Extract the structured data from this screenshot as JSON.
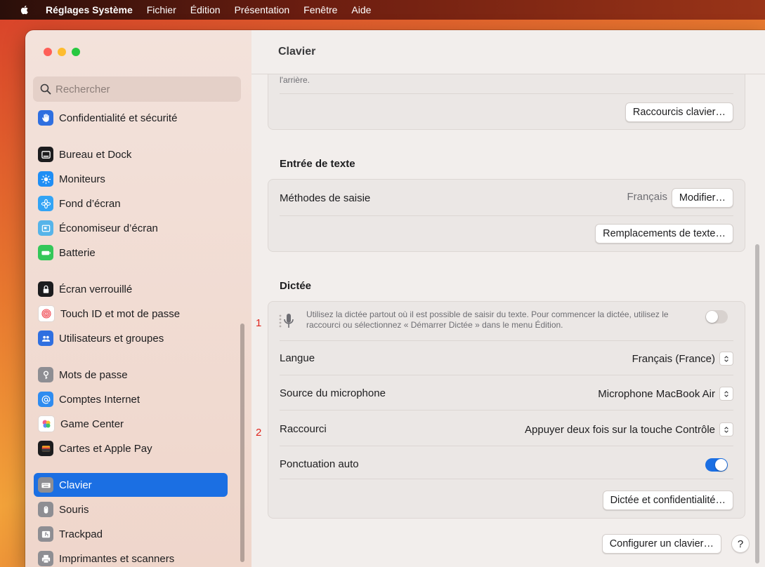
{
  "menubar": {
    "app": "Réglages Système",
    "items": [
      "Fichier",
      "Édition",
      "Présentation",
      "Fenêtre",
      "Aide"
    ]
  },
  "sidebar": {
    "search_placeholder": "Rechercher",
    "items": [
      {
        "label": "Confidentialité et sécurité",
        "icon": "hand-icon",
        "color": "#2f6fe0"
      },
      {
        "label": "Bureau et Dock",
        "icon": "dock-icon",
        "color": "#1c1c1e"
      },
      {
        "label": "Moniteurs",
        "icon": "sun-icon",
        "color": "#1f8ef5"
      },
      {
        "label": "Fond d’écran",
        "icon": "flower-icon",
        "color": "#33a4f5"
      },
      {
        "label": "Économiseur d’écran",
        "icon": "screensaver-icon",
        "color": "#56b4e9"
      },
      {
        "label": "Batterie",
        "icon": "battery-icon",
        "color": "#34c759"
      },
      {
        "label": "Écran verrouillé",
        "icon": "lock-icon",
        "color": "#1c1c1e"
      },
      {
        "label": "Touch ID et mot de passe",
        "icon": "fingerprint-icon",
        "color": "#ffffff"
      },
      {
        "label": "Utilisateurs et groupes",
        "icon": "users-icon",
        "color": "#2f6fe0"
      },
      {
        "label": "Mots de passe",
        "icon": "key-icon",
        "color": "#8e8e93"
      },
      {
        "label": "Comptes Internet",
        "icon": "at-icon",
        "color": "#2f8cf0"
      },
      {
        "label": "Game Center",
        "icon": "game-center-icon",
        "color": "#ffffff"
      },
      {
        "label": "Cartes et Apple Pay",
        "icon": "wallet-icon",
        "color": "#1c1c1e"
      },
      {
        "label": "Clavier",
        "icon": "keyboard-icon",
        "color": "#8e8e93"
      },
      {
        "label": "Souris",
        "icon": "mouse-icon",
        "color": "#8e8e93"
      },
      {
        "label": "Trackpad",
        "icon": "trackpad-icon",
        "color": "#8e8e93"
      },
      {
        "label": "Imprimantes et scanners",
        "icon": "printer-icon",
        "color": "#8e8e93"
      }
    ]
  },
  "content": {
    "title": "Clavier",
    "top_cut_text": "l'arrière.",
    "shortcuts_button": "Raccourcis clavier…",
    "text_input": {
      "section_title": "Entrée de texte",
      "input_methods_label": "Méthodes de saisie",
      "input_methods_value": "Français",
      "modify_button": "Modifier…",
      "replacements_button": "Remplacements de texte…"
    },
    "dictation": {
      "section_title": "Dictée",
      "description": "Utilisez la dictée partout où il est possible de saisir du texte. Pour commencer la dictée, utilisez le raccourci ou sélectionnez « Démarrer Dictée » dans le menu Édition.",
      "language_label": "Langue",
      "language_value": "Français (France)",
      "mic_label": "Source du microphone",
      "mic_value": "Microphone MacBook Air",
      "shortcut_label": "Raccourci",
      "shortcut_value": "Appuyer deux fois sur la touche Contrôle",
      "auto_punct_label": "Ponctuation auto",
      "privacy_button": "Dictée et confidentialité…"
    },
    "configure_button": "Configurer un clavier…",
    "help_label": "?",
    "annotations": [
      "1",
      "2"
    ]
  },
  "colors": {
    "accent": "#1b6fe3",
    "toggle_on": "#1b6fe3",
    "toggle_off": "#d8d2cf",
    "annotation": "#e0251c"
  }
}
